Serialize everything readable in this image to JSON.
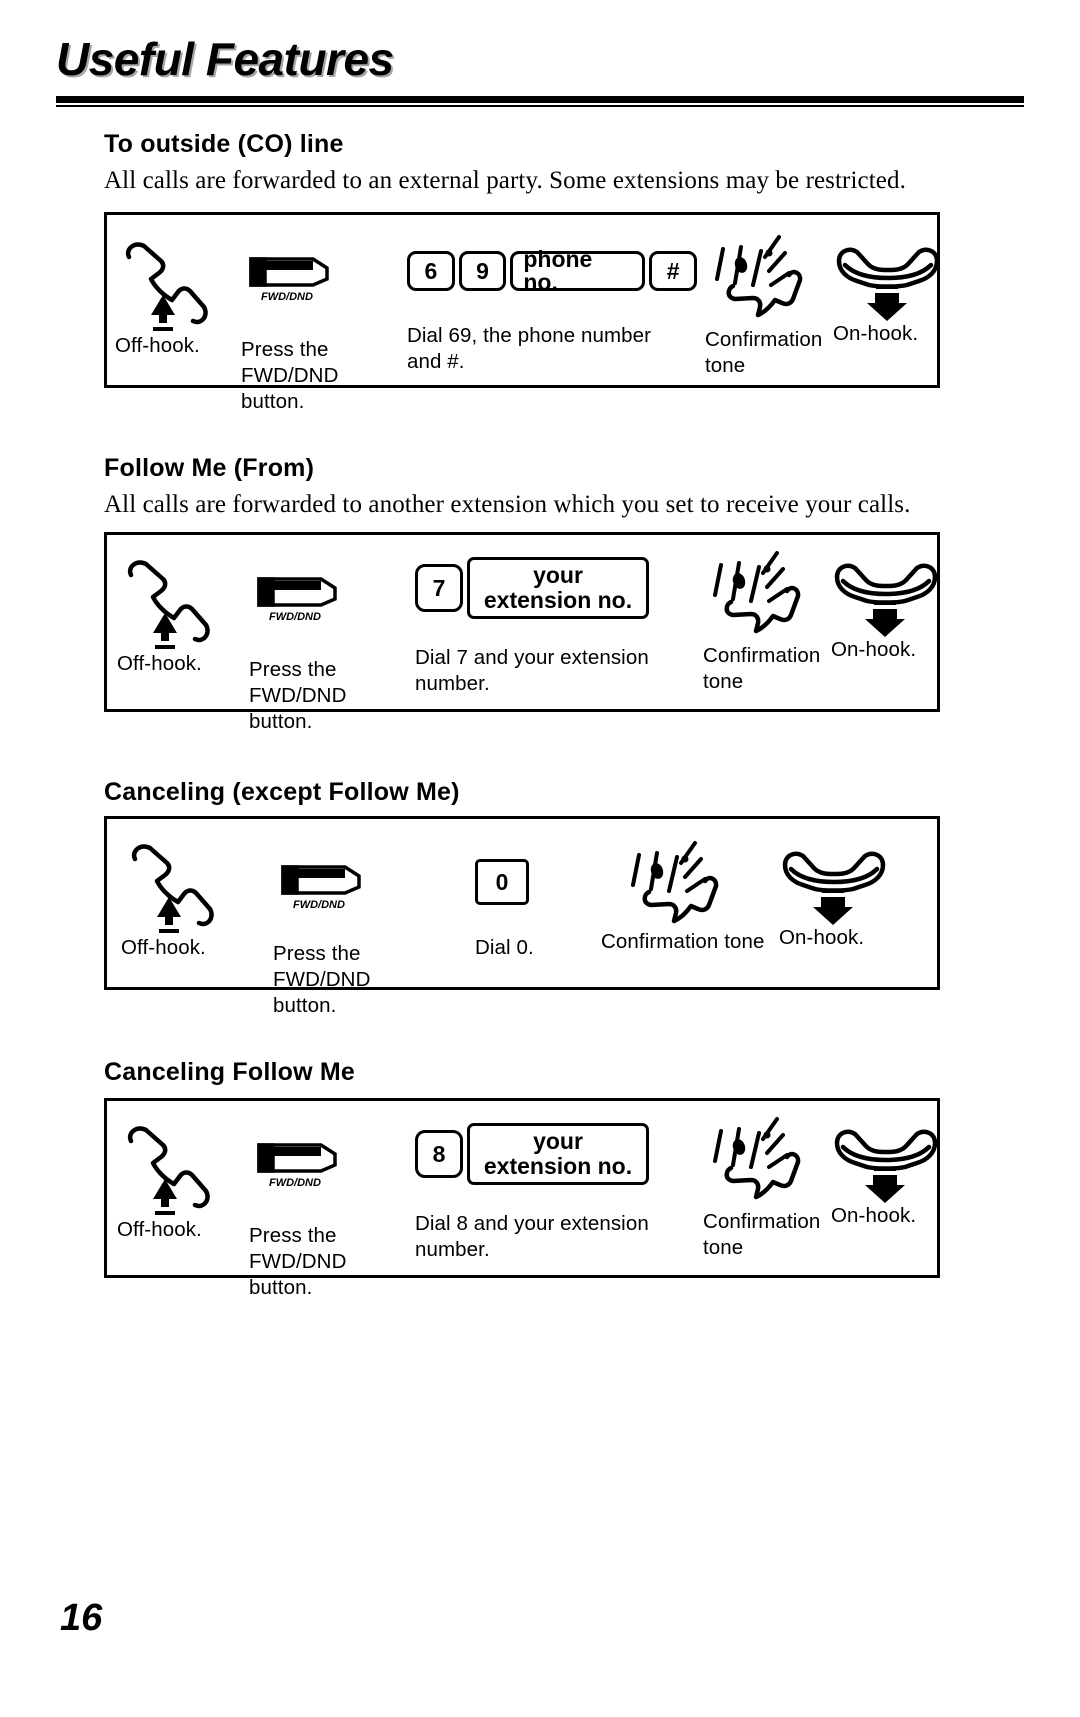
{
  "document": {
    "title": "Useful Features",
    "page_number": "16"
  },
  "sections": [
    {
      "heading": "To outside (CO) line",
      "intro": "All calls are forwarded to an external party. Some extensions may be restricted.",
      "steps": [
        {
          "icon": "offhook-handset-icon",
          "label": "Off-hook."
        },
        {
          "icon": "fwd-dnd-button-icon",
          "button_text": "FWD/DND",
          "label": "Press the\nFWD/DND button."
        },
        {
          "icon": "dial-keys-icon",
          "keys": [
            "6",
            "9",
            "phone no.",
            "#"
          ],
          "label": "Dial 69, the phone number\nand #."
        },
        {
          "icon": "confirmation-tone-icon",
          "label": "Confirmation\ntone"
        },
        {
          "icon": "onhook-handset-icon",
          "label": "On-hook."
        }
      ]
    },
    {
      "heading": "Follow Me (From)",
      "intro": "All calls are forwarded to another extension which you set to receive your calls.",
      "steps": [
        {
          "icon": "offhook-handset-icon",
          "label": "Off-hook."
        },
        {
          "icon": "fwd-dnd-button-icon",
          "button_text": "FWD/DND",
          "label": "Press the\nFWD/DND button."
        },
        {
          "icon": "dial-keys-icon",
          "keys": [
            "7"
          ],
          "key_twoline_top": "your",
          "key_twoline_bottom": "extension no.",
          "label": "Dial 7 and your extension\nnumber."
        },
        {
          "icon": "confirmation-tone-icon",
          "label": "Confirmation\ntone"
        },
        {
          "icon": "onhook-handset-icon",
          "label": "On-hook."
        }
      ]
    },
    {
      "heading": "Canceling (except Follow Me)",
      "intro": "",
      "steps": [
        {
          "icon": "offhook-handset-icon",
          "label": "Off-hook."
        },
        {
          "icon": "fwd-dnd-button-icon",
          "button_text": "FWD/DND",
          "label": "Press the\nFWD/DND button."
        },
        {
          "icon": "dial-keys-icon",
          "keys": [
            "0"
          ],
          "label": "Dial 0."
        },
        {
          "icon": "confirmation-tone-icon",
          "label": "Confirmation tone"
        },
        {
          "icon": "onhook-handset-icon",
          "label": "On-hook."
        }
      ]
    },
    {
      "heading": "Canceling Follow Me",
      "intro": "",
      "steps": [
        {
          "icon": "offhook-handset-icon",
          "label": "Off-hook."
        },
        {
          "icon": "fwd-dnd-button-icon",
          "button_text": "FWD/DND",
          "label": "Press the\nFWD/DND button."
        },
        {
          "icon": "dial-keys-icon",
          "keys": [
            "8"
          ],
          "key_twoline_top": "your",
          "key_twoline_bottom": "extension no.",
          "label": "Dial 8 and your extension\nnumber."
        },
        {
          "icon": "confirmation-tone-icon",
          "label": "Confirmation\ntone"
        },
        {
          "icon": "onhook-handset-icon",
          "label": "On-hook."
        }
      ]
    }
  ]
}
